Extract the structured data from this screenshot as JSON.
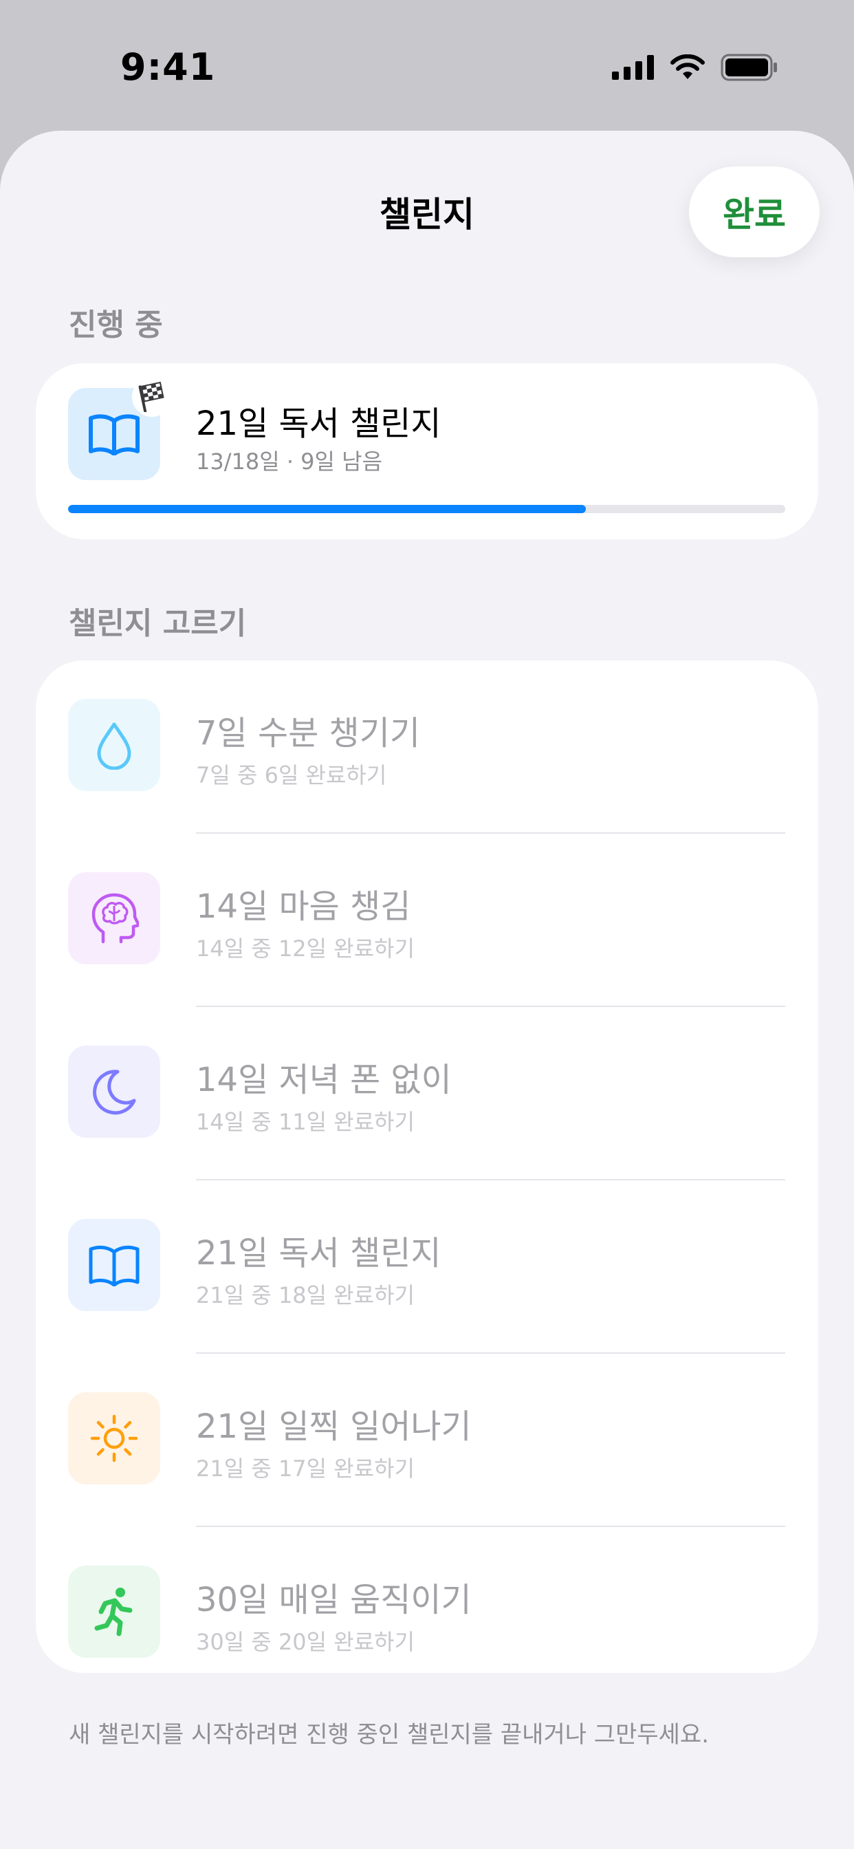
{
  "status_bar": {
    "time": "9:41"
  },
  "nav": {
    "title": "챌린지",
    "done_label": "완료"
  },
  "in_progress": {
    "header": "진행 중",
    "challenge": {
      "title": "21일 독서 챌린지",
      "subtitle": "13/18일 · 9일 남음",
      "icon": "book-icon",
      "badge_icon": "checkered-flag-icon",
      "progress_fraction": 0.722,
      "progress_color": "#0a84ff"
    }
  },
  "pick": {
    "header": "챌린지 고르기",
    "items": [
      {
        "title": "7일 수분 챙기기",
        "subtitle": "7일 중 6일 완료하기",
        "icon": "water-drop-icon",
        "color": "#5ac8fa",
        "tile": "#eaf8fe"
      },
      {
        "title": "14일 마음 챙김",
        "subtitle": "14일 중 12일 완료하기",
        "icon": "brain-head-icon",
        "color": "#bf5af2",
        "tile": "#f8edfd"
      },
      {
        "title": "14일 저녁 폰 없이",
        "subtitle": "14일 중 11일 완료하기",
        "icon": "moon-icon",
        "color": "#7d7aff",
        "tile": "#efeffe"
      },
      {
        "title": "21일 독서 챌린지",
        "subtitle": "21일 중 18일 완료하기",
        "icon": "book-icon",
        "color": "#0a84ff",
        "tile": "#e9f2fe"
      },
      {
        "title": "21일 일찍 일어나기",
        "subtitle": "21일 중 17일 완료하기",
        "icon": "sun-icon",
        "color": "#ff9f0a",
        "tile": "#fff3e6"
      },
      {
        "title": "30일 매일 움직이기",
        "subtitle": "30일 중 20일 완료하기",
        "icon": "running-figure-icon",
        "color": "#34c759",
        "tile": "#eaf8ee"
      }
    ]
  },
  "footer": "새 챌린지를 시작하려면 진행 중인 챌린지를 끝내거나 그만두세요."
}
